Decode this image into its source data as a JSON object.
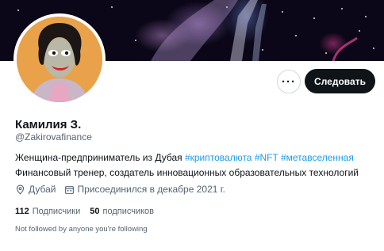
{
  "profile": {
    "display_name": "Камилия З.",
    "handle": "@Zakirovafinance",
    "bio_line1_text": "Женщина-предприниматель из Дубая ",
    "bio_tags": [
      "#криптовалюта",
      "#NFT",
      "#метавселенная"
    ],
    "bio_line2": "Финансовый тренер, создатель инновационных образовательных технологий",
    "location": "Дубай",
    "joined": "Присоединился в декабре 2021 г.",
    "followers_count": "112",
    "followers_label": "Подписчики",
    "following_count": "50",
    "following_label": "подписчиков",
    "followed_by_notice": "Not followed by anyone you're following"
  },
  "actions": {
    "more_label": "···",
    "follow_label": "Следовать"
  },
  "icons": {
    "location": "location-pin-icon",
    "calendar": "calendar-icon",
    "more": "more-options-icon"
  },
  "colors": {
    "accent": "#1d9bf0",
    "primary_text": "#0f1419",
    "secondary_text": "#536471",
    "follow_button_bg": "#0f1419"
  }
}
